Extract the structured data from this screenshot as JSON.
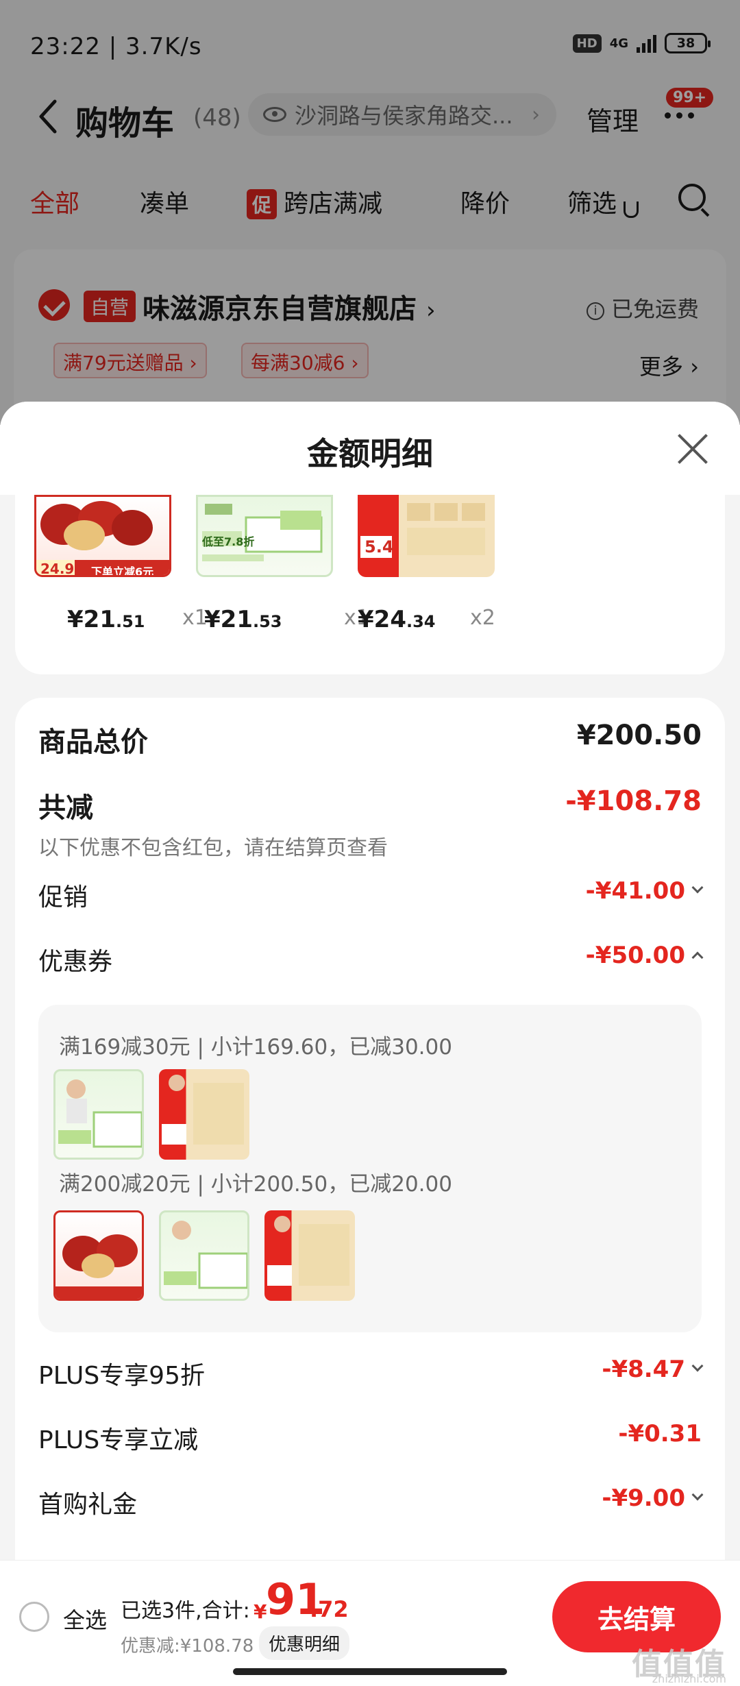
{
  "status_bar": {
    "time_speed": "23:22 | 3.7K/s",
    "hd": "HD",
    "net": "4G",
    "battery": "38"
  },
  "navbar": {
    "title": "购物车",
    "count": "(48)",
    "address": "沙洞路与侯家角路交...",
    "manage": "管理",
    "badge": "99+"
  },
  "filter_tabs": {
    "all": "全部",
    "combine": "凑单",
    "promo_tag": "促",
    "cross_store": "跨店满减",
    "price_drop": "降价",
    "filter": "筛选"
  },
  "store": {
    "self_tag": "自营",
    "name": "味滋源京东自营旗舰店",
    "chevron": "›",
    "free_shipping": "已免运费",
    "promo1": "满79元送赠品 ›",
    "promo2": "每满30减6 ›",
    "more": "更多 ›"
  },
  "sheet": {
    "title": "金额明细",
    "products": [
      {
        "price_int": "¥21",
        "price_dec": ".51",
        "qty": "x1",
        "art": "dates",
        "overlay_price": "24.9",
        "overlay_text": "下单立减6元"
      },
      {
        "price_int": "¥21",
        "price_dec": ".53",
        "qty": "x1",
        "art": "tissue-green",
        "overlay_price": "低至7.8折"
      },
      {
        "price_int": "¥24",
        "price_dec": ".34",
        "qty": "x2",
        "art": "tissue-red",
        "overlay_price": "5.4"
      }
    ]
  },
  "summary": {
    "total_label": "商品总价",
    "total_value": "¥200.50",
    "reduce_label": "共减",
    "reduce_value": "-¥108.78",
    "note": "以下优惠不包含红包，请在结算页查看",
    "promo_label": "促销",
    "promo_value": "-¥41.00",
    "coupon_label": "优惠券",
    "coupon_value": "-¥50.00",
    "coupon_lines": [
      "满169减30元 | 小计169.60，已减30.00",
      "满200减20元 | 小计200.50，已减20.00"
    ],
    "plus95_label": "PLUS专享95折",
    "plus95_value": "-¥8.47",
    "plus_reduce_label": "PLUS专享立减",
    "plus_reduce_value": "-¥0.31",
    "first_gift_label": "首购礼金",
    "first_gift_value": "-¥9.00"
  },
  "bottom": {
    "select_all": "全选",
    "summary_text": "已选3件,合计:",
    "yen": "¥",
    "total_int": "91",
    "total_dec": ".72",
    "discount": "优惠减:¥108.78",
    "detail": "优惠明细",
    "checkout": "去结算"
  },
  "watermark": {
    "text": "值值值",
    "sub": "zhizhizhi.com"
  },
  "colors": {
    "accent": "#e4261f",
    "checkout": "#f0292e"
  }
}
